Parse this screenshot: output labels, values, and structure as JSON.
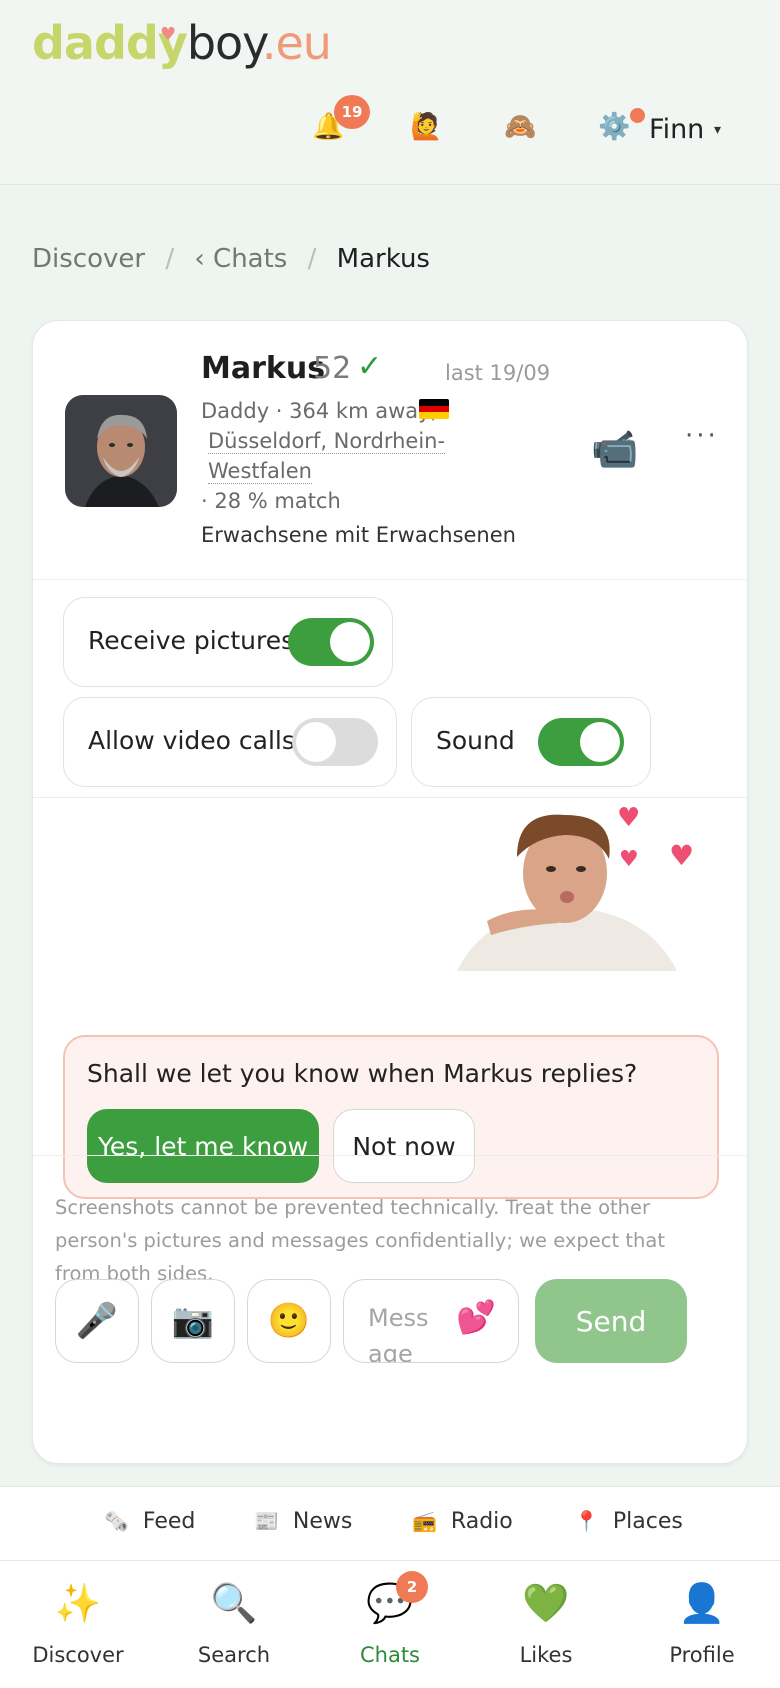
{
  "app": {
    "logo_part1": "daddy",
    "logo_part2": "boy",
    "logo_part3": ".eu"
  },
  "header": {
    "notifications_count": "19",
    "bell_icon": "🔔",
    "icon2": "🙋",
    "icon3": "🙈",
    "settings_icon": "⚙️",
    "user_name": "Finn",
    "caret": "▾"
  },
  "breadcrumb": {
    "item1": "Discover",
    "sep": "/",
    "item2": "‹ Chats",
    "item3": "Markus"
  },
  "profile": {
    "name": "Markus",
    "age": "52",
    "verified": "✓",
    "last_seen": "last 19/09",
    "line1": "Daddy · 364 km away,",
    "location_line1": "Düsseldorf, Nordrhein-",
    "location_line2": "Westfalen",
    "match": "· 28 % match",
    "preference": "Erwachsene mit Erwachsenen",
    "video_icon": "📹",
    "more": "···"
  },
  "settings": {
    "receive_pictures": "Receive pictures",
    "receive_pictures_on": true,
    "allow_video_calls": "Allow video calls",
    "allow_video_calls_on": false,
    "sound": "Sound",
    "sound_on": true
  },
  "notify": {
    "question": "Shall we let you know when Markus replies?",
    "yes": "Yes, let me know",
    "no": "Not now"
  },
  "composer": {
    "disclaimer": "Screenshots cannot be prevented technically. Treat the other person's pictures and messages confidentially; we expect that from both sides.",
    "mic": "🎤",
    "camera": "📷",
    "emoji": "🙂",
    "placeholder": "Message",
    "hearts": "💕",
    "send": "Send"
  },
  "subnav": {
    "feed": "Feed",
    "feed_icon": "🗞️",
    "news": "News",
    "news_icon": "📰",
    "radio": "Radio",
    "radio_icon": "📻",
    "places": "Places",
    "places_icon": "📍"
  },
  "tabs": {
    "discover": "Discover",
    "discover_icon": "✨",
    "search": "Search",
    "search_icon": "🔍",
    "chats": "Chats",
    "chats_icon": "💬",
    "chats_badge": "2",
    "likes": "Likes",
    "likes_icon": "💚",
    "profile": "Profile",
    "profile_icon": "👤"
  },
  "colors": {
    "accent_green": "#3c9e3e",
    "badge_orange": "#f07a55"
  }
}
